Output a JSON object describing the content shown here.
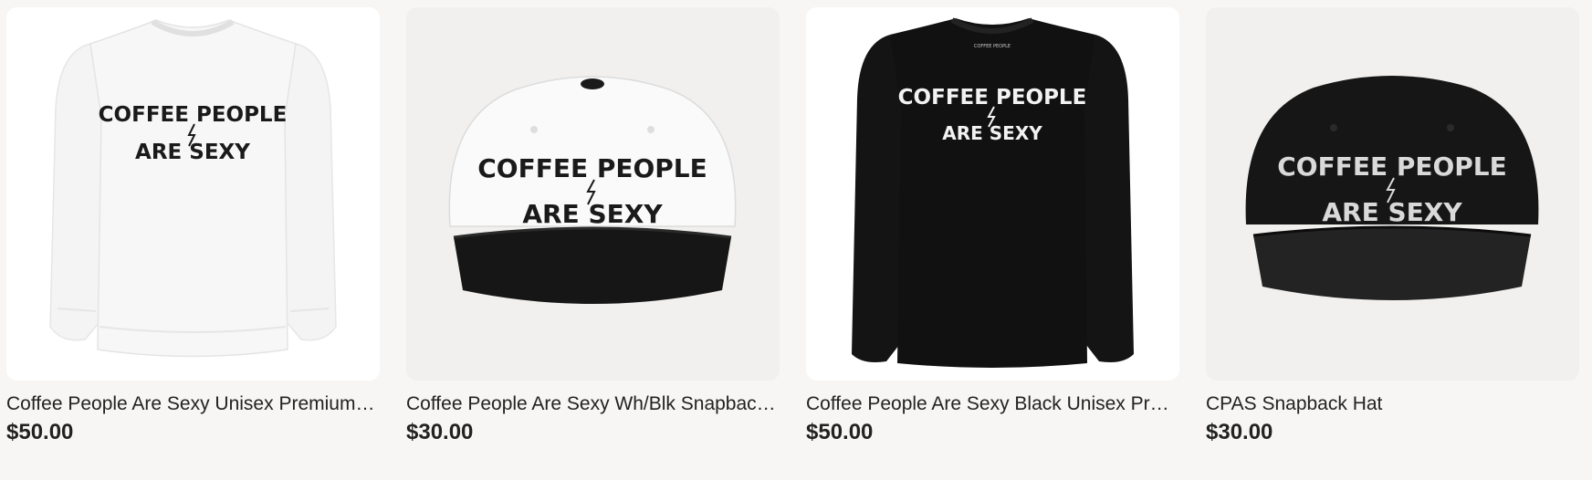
{
  "products": [
    {
      "title": "Coffee People Are Sexy Unisex Premium Sweatshirt",
      "price": "$50.00",
      "image_text_line1": "COFFEE PEOPLE",
      "image_text_line2": "ARE SEXY",
      "variant": "white-sweatshirt"
    },
    {
      "title": "Coffee People Are Sexy Wh/Blk Snapback Hat",
      "price": "$30.00",
      "image_text_line1": "COFFEE PEOPLE",
      "image_text_line2": "ARE SEXY",
      "variant": "white-black-snapback"
    },
    {
      "title": "Coffee People Are Sexy Black Unisex Premium Sweatshirt",
      "price": "$50.00",
      "image_text_line1": "COFFEE PEOPLE",
      "image_text_line2": "ARE SEXY",
      "variant": "black-sweatshirt"
    },
    {
      "title": "CPAS Snapback Hat",
      "price": "$30.00",
      "image_text_line1": "COFFEE PEOPLE",
      "image_text_line2": "ARE SEXY",
      "variant": "black-snapback"
    }
  ],
  "colors": {
    "page_background": "#f7f6f4",
    "text": "#222222",
    "white_bg": "#ffffff",
    "gray_bg": "#f1f0ef",
    "black_garment": "#121212",
    "white_garment": "#f6f6f6"
  }
}
